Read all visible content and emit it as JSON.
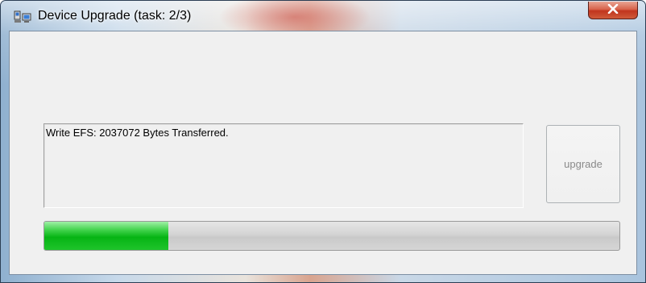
{
  "window": {
    "title": "Device Upgrade (task: 2/3)"
  },
  "titlebar": {
    "app_icon": "device-upgrade-icon",
    "close_icon": "close-icon"
  },
  "status": {
    "message": "Write EFS: 2037072 Bytes Transferred."
  },
  "buttons": {
    "upgrade_label": "upgrade",
    "upgrade_enabled": false
  },
  "progress": {
    "fraction": 0.215,
    "fill_color": "#06b414"
  },
  "colors": {
    "close_button": "#c1341d",
    "client_background": "#f0f0f0"
  }
}
